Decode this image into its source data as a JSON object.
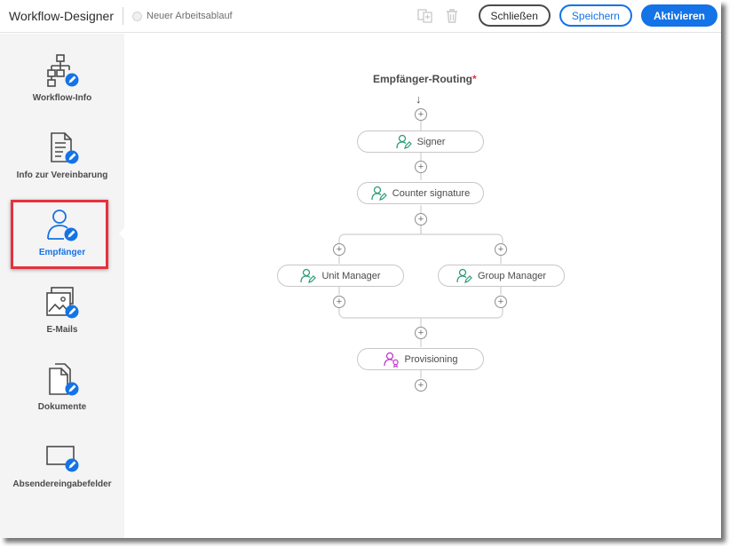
{
  "header": {
    "title": "Workflow-Designer",
    "workflow_name": "Neuer Arbeitsablauf",
    "buttons": {
      "close": "Schließen",
      "save": "Speichern",
      "activate": "Aktivieren"
    }
  },
  "sidebar": {
    "items": [
      {
        "label": "Workflow-Info",
        "icon": "workflow-hierarchy-icon"
      },
      {
        "label": "Info zur Vereinbarung",
        "icon": "document-info-icon"
      },
      {
        "label": "Empfänger",
        "icon": "user-icon",
        "active": true
      },
      {
        "label": "E-Mails",
        "icon": "image-mail-icon"
      },
      {
        "label": "Dokumente",
        "icon": "documents-icon"
      },
      {
        "label": "Absendereingabefelder",
        "icon": "input-field-icon"
      }
    ]
  },
  "routing": {
    "title": "Empfänger-Routing",
    "required_mark": "*",
    "steps": {
      "signer": "Signer",
      "counter_signature": "Counter signature",
      "unit_manager": "Unit Manager",
      "group_manager": "Group Manager",
      "provisioning": "Provisioning"
    },
    "plus_glyph": "+",
    "arrow_glyph": "↓"
  },
  "colors": {
    "accent": "#1473e6",
    "highlight": "#e5323f",
    "signer_icon": "#2d9d78",
    "provisioning_icon": "#c038cc"
  }
}
